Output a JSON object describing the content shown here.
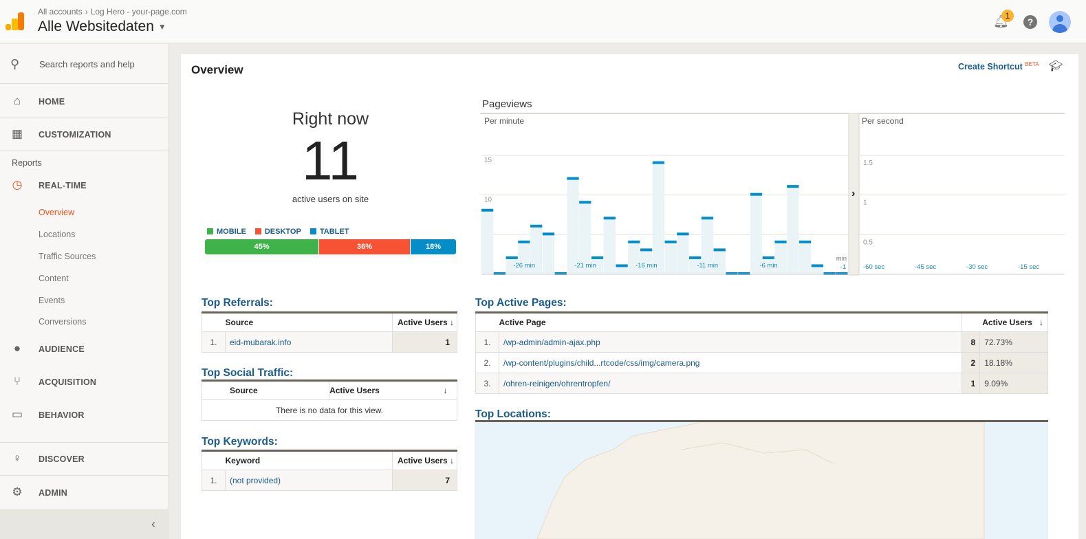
{
  "header": {
    "breadcrumb": [
      "All accounts",
      "Log Hero - your-page.com"
    ],
    "view": "Alle Websitedaten",
    "notifications": "1"
  },
  "sidebar": {
    "search": "Search reports and help",
    "home": "HOME",
    "customization": "CUSTOMIZATION",
    "reports": "Reports",
    "realtime": "REAL-TIME",
    "realtime_items": [
      "Overview",
      "Locations",
      "Traffic Sources",
      "Content",
      "Events",
      "Conversions"
    ],
    "audience": "AUDIENCE",
    "acquisition": "ACQUISITION",
    "behavior": "BEHAVIOR",
    "discover": "DISCOVER",
    "admin": "ADMIN"
  },
  "main": {
    "title": "Overview",
    "shortcut": "Create Shortcut",
    "beta": "BETA",
    "right_now": {
      "heading": "Right now",
      "count": "11",
      "subtitle": "active users on site"
    },
    "devices": [
      {
        "label": "MOBILE",
        "pct": "45%",
        "value": 45,
        "color": "#3fb34a"
      },
      {
        "label": "DESKTOP",
        "pct": "36%",
        "value": 36,
        "color": "#f75234"
      },
      {
        "label": "TABLET",
        "pct": "18%",
        "value": 18,
        "color": "#058dc7"
      }
    ],
    "referrals": {
      "title": "Top Referrals:",
      "cols": [
        "Source",
        "Active Users"
      ],
      "rows": [
        {
          "n": "1.",
          "source": "eid-mubarak.info",
          "users": "1"
        }
      ]
    },
    "social": {
      "title": "Top Social Traffic:",
      "cols": [
        "Source",
        "Active Users"
      ],
      "empty": "There is no data for this view."
    },
    "keywords": {
      "title": "Top Keywords:",
      "cols": [
        "Keyword",
        "Active Users"
      ],
      "rows": [
        {
          "n": "1.",
          "source": "(not provided)",
          "users": "7"
        }
      ]
    },
    "pages": {
      "title": "Top Active Pages:",
      "cols": [
        "Active Page",
        "Active Users"
      ],
      "rows": [
        {
          "n": "1.",
          "page": "/wp-admin/admin-ajax.php",
          "users": "8",
          "pct": "72.73%"
        },
        {
          "n": "2.",
          "page": "/wp-content/plugins/child...rtcode/css/img/camera.png",
          "users": "2",
          "pct": "18.18%"
        },
        {
          "n": "3.",
          "page": "/ohren-reinigen/ohrentropfen/",
          "users": "1",
          "pct": "9.09%"
        }
      ]
    },
    "locations": {
      "title": "Top Locations:"
    }
  },
  "chart_data": [
    {
      "type": "bar",
      "title": "Pageviews",
      "subtitle": "Per minute",
      "ylim": [
        0,
        15
      ],
      "yticks": [
        "5",
        "10",
        "15"
      ],
      "xticks": [
        "-26 min",
        "-21 min",
        "-16 min",
        "-11 min",
        "-6 min",
        "-1"
      ],
      "xunit": "min",
      "values": [
        8,
        0,
        2,
        4,
        6,
        5,
        0,
        12,
        9,
        2,
        7,
        1,
        4,
        3,
        14,
        4,
        5,
        2,
        7,
        3,
        0,
        0,
        10,
        2,
        4,
        11,
        4,
        1,
        0,
        0
      ]
    },
    {
      "type": "bar",
      "subtitle": "Per second",
      "ylim": [
        0,
        1.5
      ],
      "yticks": [
        "0.5",
        "1",
        "1.5"
      ],
      "xticks": [
        "-60 sec",
        "-45 sec",
        "-30 sec",
        "-15 sec"
      ],
      "values": []
    }
  ]
}
